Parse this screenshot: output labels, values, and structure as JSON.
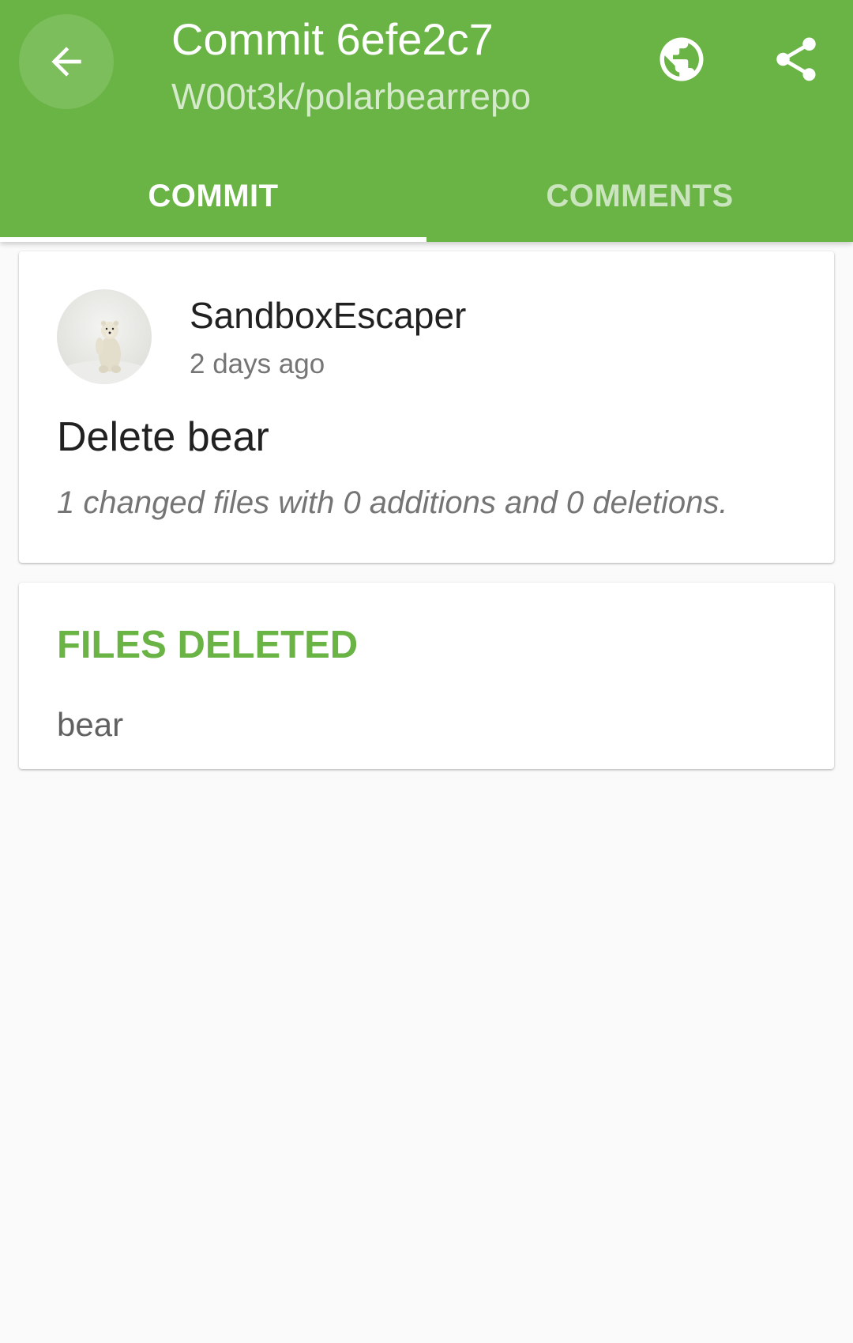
{
  "toolbar": {
    "title": "Commit 6efe2c7",
    "subtitle": "W00t3k/polarbearrepo"
  },
  "tabs": [
    {
      "label": "COMMIT",
      "active": true
    },
    {
      "label": "COMMENTS",
      "active": false
    }
  ],
  "commit": {
    "author": "SandboxEscaper",
    "time": "2 days ago",
    "message": "Delete bear",
    "summary": "1 changed files with 0 additions and 0 deletions."
  },
  "files_section": {
    "heading": "FILES DELETED",
    "files": [
      "bear"
    ]
  },
  "icons": {
    "back": "arrow-back-icon",
    "browser": "globe-icon",
    "share": "share-icon"
  },
  "colors": {
    "primary": "#69b444",
    "background": "#fafafa"
  }
}
